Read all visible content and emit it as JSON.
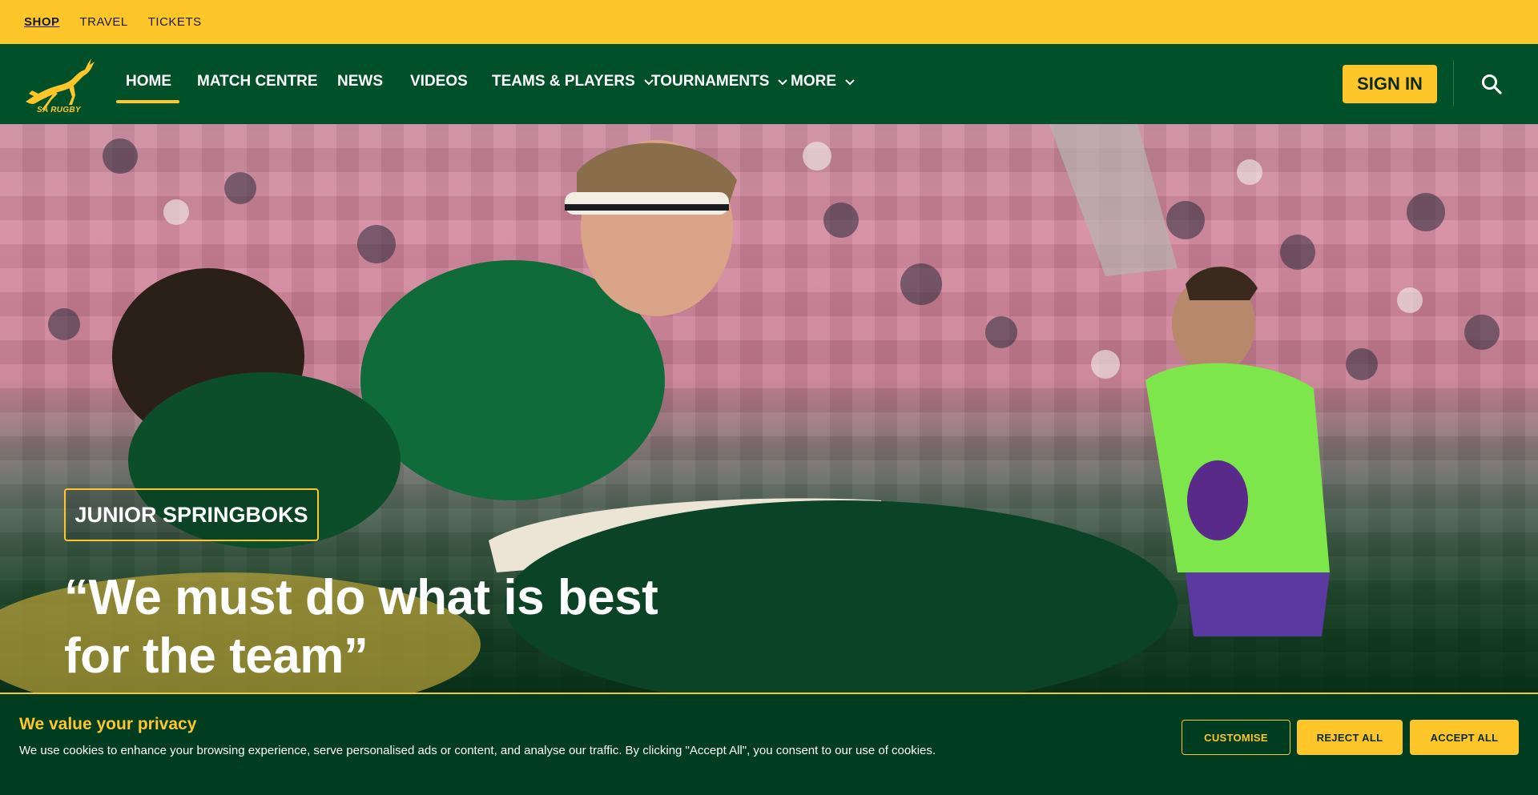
{
  "utility_nav": {
    "items": [
      {
        "label": "SHOP",
        "active": true
      },
      {
        "label": "TRAVEL",
        "active": false
      },
      {
        "label": "TICKETS",
        "active": false
      }
    ]
  },
  "main_nav": {
    "logo_text": "SA RUGBY",
    "items": [
      {
        "label": "HOME",
        "active": true,
        "has_dropdown": false
      },
      {
        "label": "MATCH CENTRE",
        "active": false,
        "has_dropdown": false
      },
      {
        "label": "NEWS",
        "active": false,
        "has_dropdown": false
      },
      {
        "label": "VIDEOS",
        "active": false,
        "has_dropdown": false
      },
      {
        "label": "TEAMS & PLAYERS",
        "active": false,
        "has_dropdown": true
      },
      {
        "label": "TOURNAMENTS",
        "active": false,
        "has_dropdown": true
      },
      {
        "label": "MORE",
        "active": false,
        "has_dropdown": true
      }
    ],
    "sign_in_label": "SIGN IN",
    "search_icon": "search-icon"
  },
  "hero": {
    "badge": "JUNIOR SPRINGBOKS",
    "title": "“We must do what is best for the team”"
  },
  "cookie_banner": {
    "title": "We value your privacy",
    "body": "We use cookies to enhance your browsing experience, serve personalised ads or content, and analyse our traffic. By clicking \"Accept All\", you consent to our use of cookies.",
    "customise_label": "CUSTOMISE",
    "reject_label": "REJECT ALL",
    "accept_label": "ACCEPT ALL"
  },
  "colors": {
    "brand_gold": "#ffc62a",
    "brand_green": "#00502a",
    "banner_green": "#003c1f"
  }
}
